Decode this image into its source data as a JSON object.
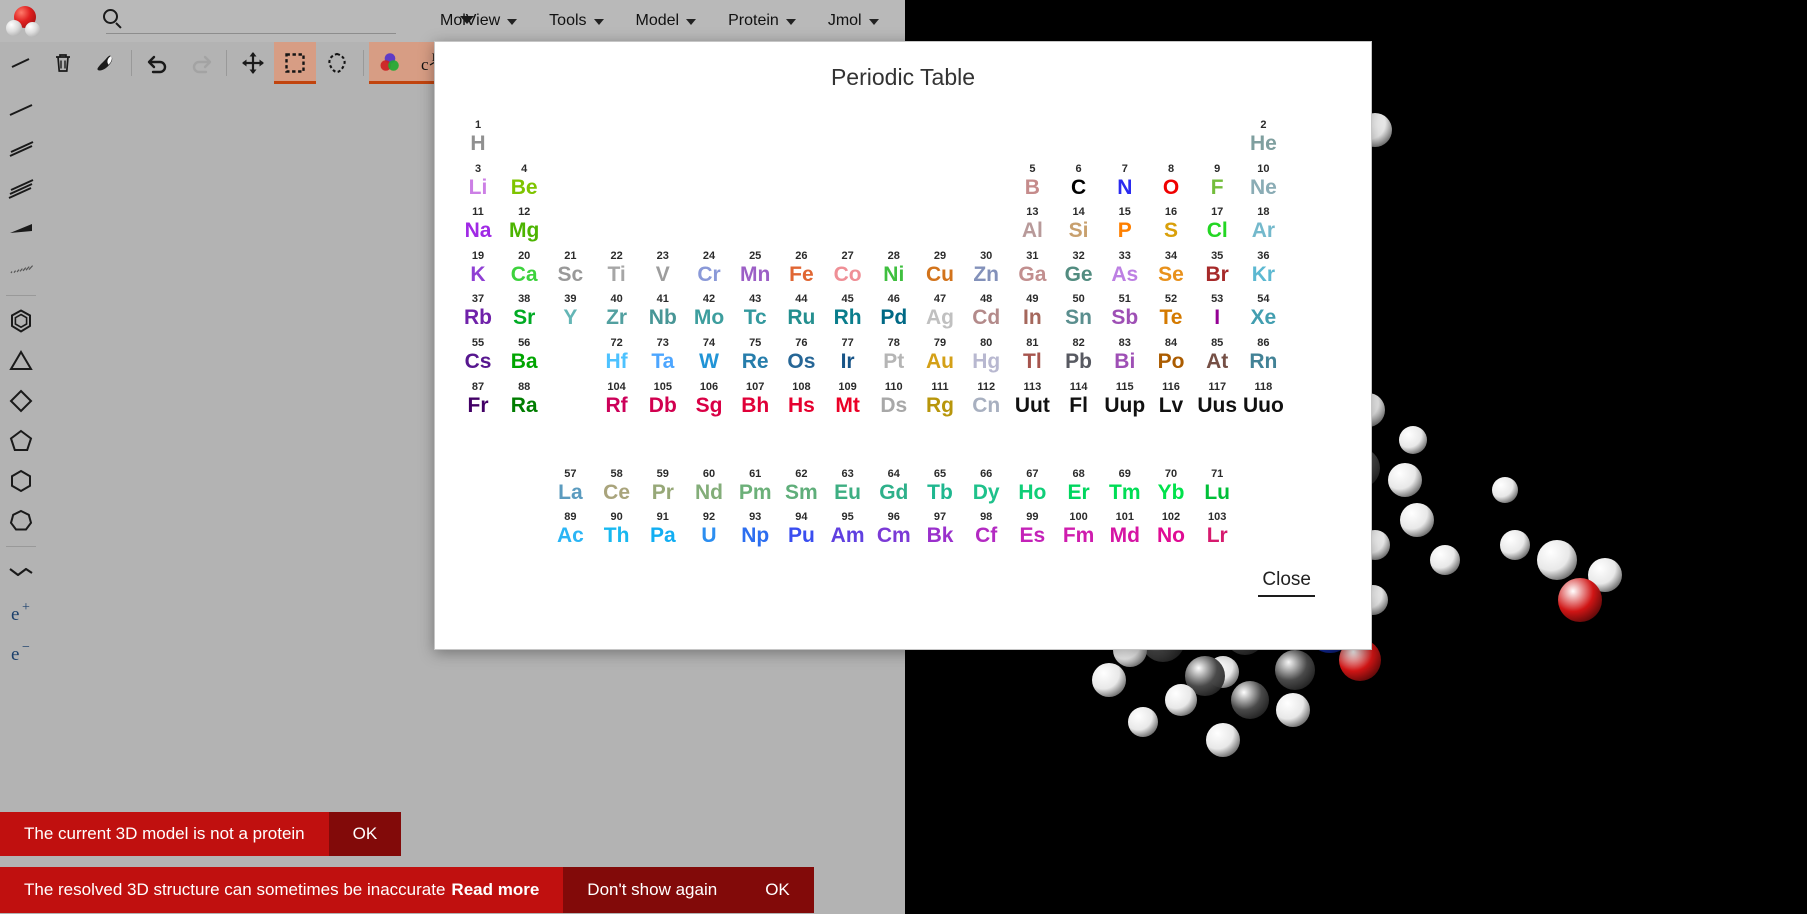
{
  "app": {
    "logo_icon": "water-molecule-logo",
    "search_placeholder": "",
    "search_value": ""
  },
  "menubar": [
    {
      "label": "MolView"
    },
    {
      "label": "Tools"
    },
    {
      "label": "Model"
    },
    {
      "label": "Protein"
    },
    {
      "label": "Jmol"
    }
  ],
  "toolbar": [
    {
      "name": "bond-tool",
      "icon": "single-bond-icon",
      "active": false
    },
    {
      "name": "delete-tool",
      "icon": "trash-icon",
      "active": false
    },
    {
      "name": "eraser-tool",
      "icon": "eraser-icon",
      "active": false
    },
    {
      "name": "undo-button",
      "icon": "undo-arrow-icon",
      "active": false
    },
    {
      "name": "redo-button",
      "icon": "redo-arrow-icon",
      "active": false
    },
    {
      "name": "move-tool",
      "icon": "move-arrows-icon",
      "active": false
    },
    {
      "name": "rect-select-tool",
      "icon": "dashed-square-icon",
      "active": true
    },
    {
      "name": "lasso-select-tool",
      "icon": "lasso-icon",
      "active": false
    },
    {
      "name": "color-tool",
      "icon": "color-circles-icon",
      "active": true
    },
    {
      "name": "hydrogen-tool",
      "icon": "carbon-hydrogen-icon",
      "active": true
    }
  ],
  "leftbar": [
    {
      "name": "single-bond-tool",
      "icon": "single-line-icon"
    },
    {
      "name": "double-bond-tool",
      "icon": "double-line-icon"
    },
    {
      "name": "triple-bond-tool",
      "icon": "triple-line-icon"
    },
    {
      "name": "wedge-bond-tool",
      "icon": "wedge-bond-icon"
    },
    {
      "name": "hash-bond-tool",
      "icon": "hashed-bond-icon"
    },
    {
      "name": "benzene-tool",
      "icon": "benzene-ring-icon"
    },
    {
      "name": "triangle-tool",
      "icon": "triangle-icon"
    },
    {
      "name": "square-tool",
      "icon": "diamond-icon"
    },
    {
      "name": "pentagon-tool",
      "icon": "pentagon-icon"
    },
    {
      "name": "hexagon-tool",
      "icon": "hexagon-icon"
    },
    {
      "name": "heptagon-tool",
      "icon": "heptagon-icon"
    },
    {
      "name": "chain-tool",
      "icon": "zigzag-chain-icon"
    },
    {
      "name": "positive-charge-tool",
      "icon": "e-plus-icon",
      "label": "e"
    },
    {
      "name": "negative-charge-tool",
      "icon": "e-minus-icon",
      "label": "e"
    }
  ],
  "dialog": {
    "title": "Periodic Table",
    "close_label": "Close"
  },
  "periodic_table": {
    "elements": [
      {
        "n": 1,
        "sym": "H",
        "g": 1,
        "p": 1,
        "color": "#909090"
      },
      {
        "n": 2,
        "sym": "He",
        "g": 18,
        "p": 1,
        "color": "#7f9f9f"
      },
      {
        "n": 3,
        "sym": "Li",
        "g": 1,
        "p": 2,
        "color": "#cc7fe5"
      },
      {
        "n": 4,
        "sym": "Be",
        "g": 2,
        "p": 2,
        "color": "#7fc400"
      },
      {
        "n": 5,
        "sym": "B",
        "g": 13,
        "p": 2,
        "color": "#c58b8b"
      },
      {
        "n": 6,
        "sym": "C",
        "g": 14,
        "p": 2,
        "color": "#000000"
      },
      {
        "n": 7,
        "sym": "N",
        "g": 15,
        "p": 2,
        "color": "#2A2AF0"
      },
      {
        "n": 8,
        "sym": "O",
        "g": 16,
        "p": 2,
        "color": "#F00000"
      },
      {
        "n": 9,
        "sym": "F",
        "g": 17,
        "p": 2,
        "color": "#73bd3b"
      },
      {
        "n": 10,
        "sym": "Ne",
        "g": 18,
        "p": 2,
        "color": "#8aacb5"
      },
      {
        "n": 11,
        "sym": "Na",
        "g": 1,
        "p": 3,
        "color": "#a029e5"
      },
      {
        "n": 12,
        "sym": "Mg",
        "g": 2,
        "p": 3,
        "color": "#4cb400"
      },
      {
        "n": 13,
        "sym": "Al",
        "g": 13,
        "p": 3,
        "color": "#b89a9a"
      },
      {
        "n": 14,
        "sym": "Si",
        "g": 14,
        "p": 3,
        "color": "#c8a06e"
      },
      {
        "n": 15,
        "sym": "P",
        "g": 15,
        "p": 3,
        "color": "#FF8000"
      },
      {
        "n": 16,
        "sym": "S",
        "g": 16,
        "p": 3,
        "color": "#d9a00a"
      },
      {
        "n": 17,
        "sym": "Cl",
        "g": 17,
        "p": 3,
        "color": "#23d623"
      },
      {
        "n": 18,
        "sym": "Ar",
        "g": 18,
        "p": 3,
        "color": "#74b9cc"
      },
      {
        "n": 19,
        "sym": "K",
        "g": 1,
        "p": 4,
        "color": "#8f3fd4"
      },
      {
        "n": 20,
        "sym": "Ca",
        "g": 2,
        "p": 4,
        "color": "#3dd23d"
      },
      {
        "n": 21,
        "sym": "Sc",
        "g": 3,
        "p": 4,
        "color": "#999999"
      },
      {
        "n": 22,
        "sym": "Ti",
        "g": 4,
        "p": 4,
        "color": "#a6a6a6"
      },
      {
        "n": 23,
        "sym": "V",
        "g": 5,
        "p": 4,
        "color": "#9d9d9d"
      },
      {
        "n": 24,
        "sym": "Cr",
        "g": 6,
        "p": 4,
        "color": "#8a99d8"
      },
      {
        "n": 25,
        "sym": "Mn",
        "g": 7,
        "p": 4,
        "color": "#9c5fc6"
      },
      {
        "n": 26,
        "sym": "Fe",
        "g": 8,
        "p": 4,
        "color": "#e06633"
      },
      {
        "n": 27,
        "sym": "Co",
        "g": 9,
        "p": 4,
        "color": "#ef8f96"
      },
      {
        "n": 28,
        "sym": "Ni",
        "g": 10,
        "p": 4,
        "color": "#3fbf3f"
      },
      {
        "n": 29,
        "sym": "Cu",
        "g": 11,
        "p": 4,
        "color": "#d2731b"
      },
      {
        "n": 30,
        "sym": "Zn",
        "g": 12,
        "p": 4,
        "color": "#8391ba"
      },
      {
        "n": 31,
        "sym": "Ga",
        "g": 13,
        "p": 4,
        "color": "#c28f8f"
      },
      {
        "n": 32,
        "sym": "Ge",
        "g": 14,
        "p": 4,
        "color": "#528c80"
      },
      {
        "n": 33,
        "sym": "As",
        "g": 15,
        "p": 4,
        "color": "#bd80e3"
      },
      {
        "n": 34,
        "sym": "Se",
        "g": 16,
        "p": 4,
        "color": "#e8911c"
      },
      {
        "n": 35,
        "sym": "Br",
        "g": 17,
        "p": 4,
        "color": "#a62929"
      },
      {
        "n": 36,
        "sym": "Kr",
        "g": 18,
        "p": 4,
        "color": "#5cb8d1"
      },
      {
        "n": 37,
        "sym": "Rb",
        "g": 1,
        "p": 5,
        "color": "#7022aa"
      },
      {
        "n": 38,
        "sym": "Sr",
        "g": 2,
        "p": 5,
        "color": "#00ab24"
      },
      {
        "n": 39,
        "sym": "Y",
        "g": 3,
        "p": 5,
        "color": "#64b6b6"
      },
      {
        "n": 40,
        "sym": "Zr",
        "g": 4,
        "p": 5,
        "color": "#52a0a0"
      },
      {
        "n": 41,
        "sym": "Nb",
        "g": 5,
        "p": 5,
        "color": "#489696"
      },
      {
        "n": 42,
        "sym": "Mo",
        "g": 6,
        "p": 5,
        "color": "#3d9e9e"
      },
      {
        "n": 43,
        "sym": "Tc",
        "g": 7,
        "p": 5,
        "color": "#33999e"
      },
      {
        "n": 44,
        "sym": "Ru",
        "g": 8,
        "p": 5,
        "color": "#248f8f"
      },
      {
        "n": 45,
        "sym": "Rh",
        "g": 9,
        "p": 5,
        "color": "#0a7d8c"
      },
      {
        "n": 46,
        "sym": "Pd",
        "g": 10,
        "p": 5,
        "color": "#006985"
      },
      {
        "n": 47,
        "sym": "Ag",
        "g": 11,
        "p": 5,
        "color": "#c0c0c0"
      },
      {
        "n": 48,
        "sym": "Cd",
        "g": 12,
        "p": 5,
        "color": "#b38a8a"
      },
      {
        "n": 49,
        "sym": "In",
        "g": 13,
        "p": 5,
        "color": "#a5675c"
      },
      {
        "n": 50,
        "sym": "Sn",
        "g": 14,
        "p": 5,
        "color": "#5a8e8e"
      },
      {
        "n": 51,
        "sym": "Sb",
        "g": 15,
        "p": 5,
        "color": "#9e4fb5"
      },
      {
        "n": 52,
        "sym": "Te",
        "g": 16,
        "p": 5,
        "color": "#d47a00"
      },
      {
        "n": 53,
        "sym": "I",
        "g": 17,
        "p": 5,
        "color": "#940094"
      },
      {
        "n": 54,
        "sym": "Xe",
        "g": 18,
        "p": 5,
        "color": "#429eb0"
      },
      {
        "n": 55,
        "sym": "Cs",
        "g": 1,
        "p": 6,
        "color": "#57178f"
      },
      {
        "n": 56,
        "sym": "Ba",
        "g": 2,
        "p": 6,
        "color": "#00a500"
      },
      {
        "n": 72,
        "sym": "Hf",
        "g": 4,
        "p": 6,
        "color": "#4dc2ff"
      },
      {
        "n": 73,
        "sym": "Ta",
        "g": 5,
        "p": 6,
        "color": "#4da6ff"
      },
      {
        "n": 74,
        "sym": "W",
        "g": 6,
        "p": 6,
        "color": "#2194d6"
      },
      {
        "n": 75,
        "sym": "Re",
        "g": 7,
        "p": 6,
        "color": "#267dab"
      },
      {
        "n": 76,
        "sym": "Os",
        "g": 8,
        "p": 6,
        "color": "#266696"
      },
      {
        "n": 77,
        "sym": "Ir",
        "g": 9,
        "p": 6,
        "color": "#175487"
      },
      {
        "n": 78,
        "sym": "Pt",
        "g": 10,
        "p": 6,
        "color": "#b5b5b5"
      },
      {
        "n": 79,
        "sym": "Au",
        "g": 11,
        "p": 6,
        "color": "#d4a017"
      },
      {
        "n": 80,
        "sym": "Hg",
        "g": 12,
        "p": 6,
        "color": "#b8b8d0"
      },
      {
        "n": 81,
        "sym": "Tl",
        "g": 13,
        "p": 6,
        "color": "#a6544d"
      },
      {
        "n": 82,
        "sym": "Pb",
        "g": 14,
        "p": 6,
        "color": "#575961"
      },
      {
        "n": 83,
        "sym": "Bi",
        "g": 15,
        "p": 6,
        "color": "#9e4fb5"
      },
      {
        "n": 84,
        "sym": "Po",
        "g": 16,
        "p": 6,
        "color": "#ab5c00"
      },
      {
        "n": 85,
        "sym": "At",
        "g": 17,
        "p": 6,
        "color": "#754f45"
      },
      {
        "n": 86,
        "sym": "Rn",
        "g": 18,
        "p": 6,
        "color": "#428296"
      },
      {
        "n": 87,
        "sym": "Fr",
        "g": 1,
        "p": 7,
        "color": "#420066"
      },
      {
        "n": 88,
        "sym": "Ra",
        "g": 2,
        "p": 7,
        "color": "#007d00"
      },
      {
        "n": 104,
        "sym": "Rf",
        "g": 4,
        "p": 7,
        "color": "#cc0059"
      },
      {
        "n": 105,
        "sym": "Db",
        "g": 5,
        "p": 7,
        "color": "#d1004f"
      },
      {
        "n": 106,
        "sym": "Sg",
        "g": 6,
        "p": 7,
        "color": "#d90045"
      },
      {
        "n": 107,
        "sym": "Bh",
        "g": 7,
        "p": 7,
        "color": "#e00038"
      },
      {
        "n": 108,
        "sym": "Hs",
        "g": 8,
        "p": 7,
        "color": "#e6002e"
      },
      {
        "n": 109,
        "sym": "Mt",
        "g": 9,
        "p": 7,
        "color": "#eb0026"
      },
      {
        "n": 110,
        "sym": "Ds",
        "g": 10,
        "p": 7,
        "color": "#a8a8a8"
      },
      {
        "n": 111,
        "sym": "Rg",
        "g": 11,
        "p": 7,
        "color": "#b8960b"
      },
      {
        "n": 112,
        "sym": "Cn",
        "g": 12,
        "p": 7,
        "color": "#a8b0c0"
      },
      {
        "n": 113,
        "sym": "Uut",
        "g": 13,
        "p": 7,
        "color": "#111111"
      },
      {
        "n": 114,
        "sym": "Fl",
        "g": 14,
        "p": 7,
        "color": "#111111"
      },
      {
        "n": 115,
        "sym": "Uup",
        "g": 15,
        "p": 7,
        "color": "#111111"
      },
      {
        "n": 116,
        "sym": "Lv",
        "g": 16,
        "p": 7,
        "color": "#111111"
      },
      {
        "n": 117,
        "sym": "Uus",
        "g": 17,
        "p": 7,
        "color": "#111111"
      },
      {
        "n": 118,
        "sym": "Uuo",
        "g": 18,
        "p": 7,
        "color": "#111111"
      },
      {
        "n": 57,
        "sym": "La",
        "g": 3,
        "p": 9,
        "color": "#5b9bbf"
      },
      {
        "n": 58,
        "sym": "Ce",
        "g": 4,
        "p": 9,
        "color": "#a9a47c"
      },
      {
        "n": 59,
        "sym": "Pr",
        "g": 5,
        "p": 9,
        "color": "#97a878"
      },
      {
        "n": 60,
        "sym": "Nd",
        "g": 6,
        "p": 9,
        "color": "#83ad79"
      },
      {
        "n": 61,
        "sym": "Pm",
        "g": 7,
        "p": 9,
        "color": "#6cb079"
      },
      {
        "n": 62,
        "sym": "Sm",
        "g": 8,
        "p": 9,
        "color": "#5fae7a"
      },
      {
        "n": 63,
        "sym": "Eu",
        "g": 9,
        "p": 9,
        "color": "#3dae82"
      },
      {
        "n": 64,
        "sym": "Gd",
        "g": 10,
        "p": 9,
        "color": "#2eb08a"
      },
      {
        "n": 65,
        "sym": "Tb",
        "g": 11,
        "p": 9,
        "color": "#1fb78f"
      },
      {
        "n": 66,
        "sym": "Dy",
        "g": 12,
        "p": 9,
        "color": "#1fc18b"
      },
      {
        "n": 67,
        "sym": "Ho",
        "g": 13,
        "p": 9,
        "color": "#0fce78"
      },
      {
        "n": 68,
        "sym": "Er",
        "g": 14,
        "p": 9,
        "color": "#00d65e"
      },
      {
        "n": 69,
        "sym": "Tm",
        "g": 15,
        "p": 9,
        "color": "#00dd55"
      },
      {
        "n": 70,
        "sym": "Yb",
        "g": 16,
        "p": 9,
        "color": "#00e24b"
      },
      {
        "n": 71,
        "sym": "Lu",
        "g": 17,
        "p": 9,
        "color": "#00bf38"
      },
      {
        "n": 89,
        "sym": "Ac",
        "g": 3,
        "p": 10,
        "color": "#2bb5f5"
      },
      {
        "n": 90,
        "sym": "Th",
        "g": 4,
        "p": 10,
        "color": "#18b8f0"
      },
      {
        "n": 91,
        "sym": "Pa",
        "g": 5,
        "p": 10,
        "color": "#12aef2"
      },
      {
        "n": 92,
        "sym": "U",
        "g": 6,
        "p": 10,
        "color": "#2c8ef0"
      },
      {
        "n": 93,
        "sym": "Np",
        "g": 7,
        "p": 10,
        "color": "#2c6ef0"
      },
      {
        "n": 94,
        "sym": "Pu",
        "g": 8,
        "p": 10,
        "color": "#3a4ef0"
      },
      {
        "n": 95,
        "sym": "Am",
        "g": 9,
        "p": 10,
        "color": "#6040e0"
      },
      {
        "n": 96,
        "sym": "Cm",
        "g": 10,
        "p": 10,
        "color": "#7b3ad6"
      },
      {
        "n": 97,
        "sym": "Bk",
        "g": 11,
        "p": 10,
        "color": "#9a30cc"
      },
      {
        "n": 98,
        "sym": "Cf",
        "g": 12,
        "p": 10,
        "color": "#b32ac2"
      },
      {
        "n": 99,
        "sym": "Es",
        "g": 13,
        "p": 10,
        "color": "#c422b8"
      },
      {
        "n": 100,
        "sym": "Fm",
        "g": 14,
        "p": 10,
        "color": "#cf1cae"
      },
      {
        "n": 101,
        "sym": "Md",
        "g": 15,
        "p": 10,
        "color": "#d515a4"
      },
      {
        "n": 102,
        "sym": "No",
        "g": 16,
        "p": 10,
        "color": "#e00c94"
      },
      {
        "n": 103,
        "sym": "Lr",
        "g": 17,
        "p": 10,
        "color": "#d61a6e"
      }
    ]
  },
  "notifications": [
    {
      "message": "The current 3D model is not a protein",
      "message_bold": "",
      "actions": [
        {
          "label": "OK"
        }
      ]
    },
    {
      "message": "The resolved 3D structure can sometimes be inaccurate",
      "message_bold": "Read more",
      "actions": [
        {
          "label": "Don't show again"
        },
        {
          "label": "OK"
        }
      ]
    }
  ],
  "colors": {
    "toolbar_active": "#d79d84",
    "toolbar_active_underline": "#c1440e",
    "notification_bg": "#c0100f",
    "notification_action_bg": "#820a09",
    "chrome_bg": "#b3b3b3",
    "viewer_bg": "#000000"
  }
}
